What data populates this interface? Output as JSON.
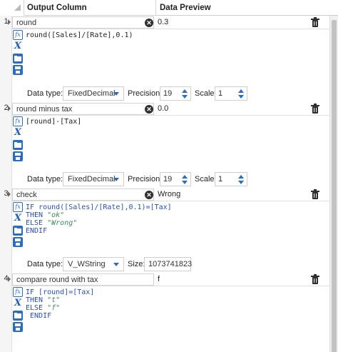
{
  "header": {
    "output_column": "Output Column",
    "data_preview": "Data Preview"
  },
  "labels": {
    "data_type": "Data type:",
    "precision": "Precision:",
    "scale": "Scale:",
    "size": "Size:"
  },
  "rows": [
    {
      "num": "1",
      "name": "round",
      "preview": "0.3",
      "expression_lines": [
        "round([Sales]/[Rate],0.1)"
      ],
      "data_type": "FixedDecimal",
      "precision": "19",
      "scale": "1"
    },
    {
      "num": "2",
      "name": "round minus tax",
      "preview": "0.0",
      "expression_lines": [
        "[round]-[Tax]"
      ],
      "data_type": "FixedDecimal",
      "precision": "19",
      "scale": "1"
    },
    {
      "num": "3",
      "name": "check",
      "preview": "Wrong",
      "expression_lines": [
        "IF round([Sales]/[Rate],0.1)=[Tax]",
        "THEN \"ok\"",
        "ELSE \"Wrong\"",
        "ENDIF"
      ],
      "data_type": "V_WString",
      "size": "1073741823"
    },
    {
      "num": "4",
      "name": "compare round with tax",
      "preview": "f",
      "expression_lines": [
        "IF [round]=[Tax]",
        "THEN \"t\"",
        "ELSE \"f\"",
        " ENDIF"
      ]
    }
  ],
  "icons": {
    "function": "fx-icon",
    "variable": "x-icon",
    "open": "open-folder-icon",
    "save": "save-icon",
    "delete": "trash-icon",
    "clear": "clear-x-icon"
  },
  "colors": {
    "accent": "#2a6cc0",
    "keyword": "#2a4fb4",
    "string": "#3a8a5a"
  }
}
